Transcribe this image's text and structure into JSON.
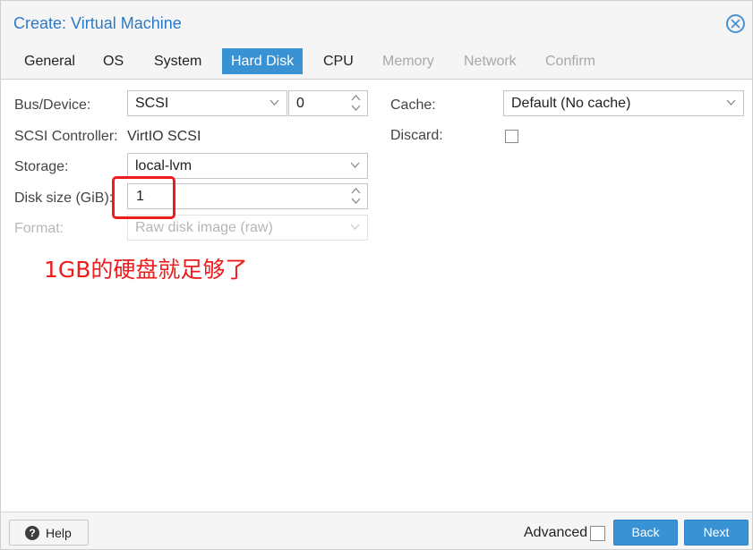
{
  "window": {
    "title": "Create: Virtual Machine",
    "close_icon": "close-circle-icon",
    "accent_color": "#3892d4"
  },
  "tabs": [
    {
      "label": "General",
      "state": "normal"
    },
    {
      "label": "OS",
      "state": "normal"
    },
    {
      "label": "System",
      "state": "normal"
    },
    {
      "label": "Hard Disk",
      "state": "active"
    },
    {
      "label": "CPU",
      "state": "normal"
    },
    {
      "label": "Memory",
      "state": "disabled"
    },
    {
      "label": "Network",
      "state": "disabled"
    },
    {
      "label": "Confirm",
      "state": "disabled"
    }
  ],
  "form": {
    "bus_device": {
      "label": "Bus/Device:",
      "bus_value": "SCSI",
      "device_value": "0"
    },
    "scsi_controller": {
      "label": "SCSI Controller:",
      "value": "VirtIO SCSI"
    },
    "storage": {
      "label": "Storage:",
      "value": "local-lvm"
    },
    "disk_size": {
      "label": "Disk size (GiB):",
      "value": "1"
    },
    "format": {
      "label": "Format:",
      "value": "Raw disk image (raw)"
    },
    "cache": {
      "label": "Cache:",
      "value": "Default (No cache)"
    },
    "discard": {
      "label": "Discard:",
      "checked": false
    }
  },
  "annotation": {
    "text": "1GB的硬盘就足够了",
    "color": "#ee1c1c"
  },
  "footer": {
    "help_label": "Help",
    "help_icon": "question-circle-icon",
    "advanced_label": "Advanced",
    "advanced_checked": false,
    "back_label": "Back",
    "next_label": "Next"
  }
}
